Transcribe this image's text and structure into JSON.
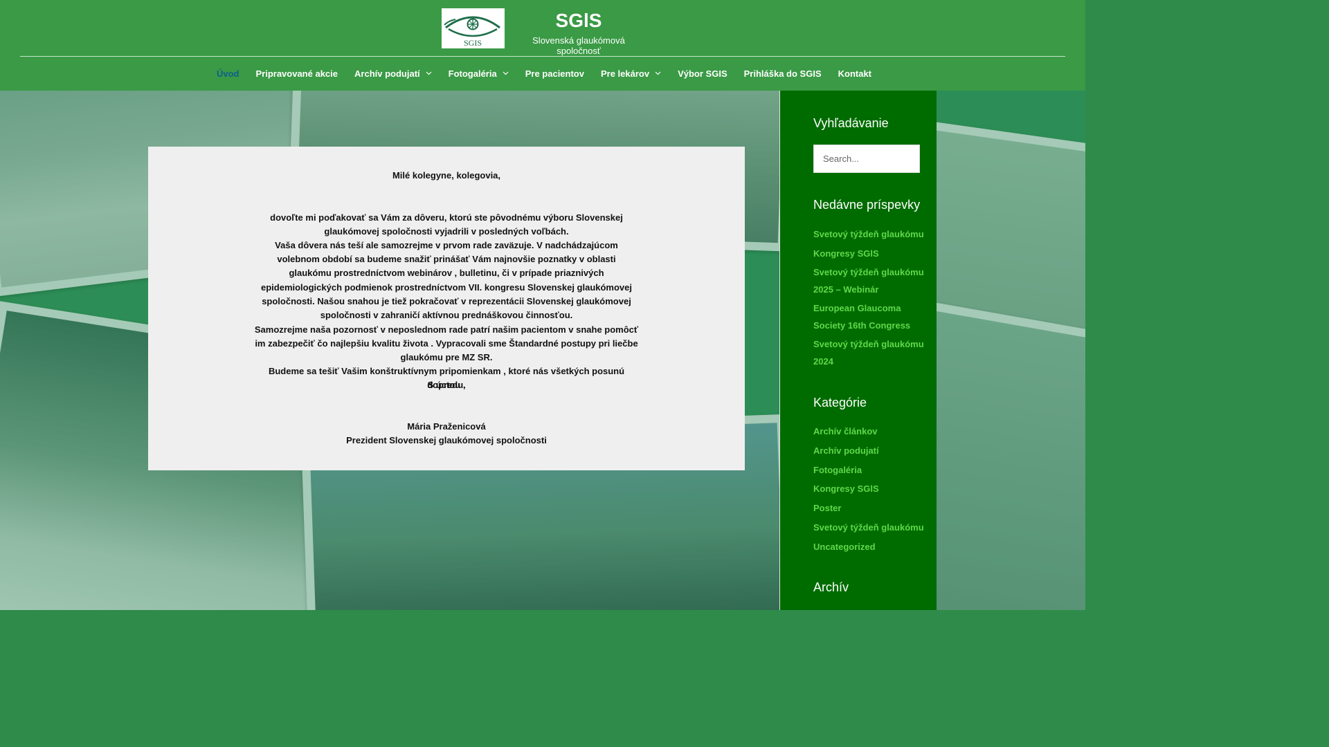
{
  "header": {
    "logo_text": "SGIS",
    "site_title": "SGlS",
    "tagline": "Slovenská glaukómová spoločnosť"
  },
  "nav": {
    "items": [
      {
        "label": "Úvod",
        "active": true,
        "dropdown": false
      },
      {
        "label": "Pripravované akcie",
        "dropdown": false
      },
      {
        "label": "Archív podujatí",
        "dropdown": true
      },
      {
        "label": "Fotogaléria",
        "dropdown": true
      },
      {
        "label": "Pre pacientov",
        "dropdown": false
      },
      {
        "label": "Pre lekárov",
        "dropdown": true
      },
      {
        "label": "Výbor SGIS",
        "dropdown": false
      },
      {
        "label": "Prihláška do SGIS",
        "dropdown": false
      },
      {
        "label": "Kontakt",
        "dropdown": false
      }
    ]
  },
  "content": {
    "greeting": "Milé kolegyne, kolegovia,",
    "para1": "dovoľte mi poďakovať sa Vám za dôveru, ktorú ste pôvodnému výboru Slovenskej glaukómovej spoločnosti vyjadrili v posledných voľbách.",
    "para2": "Vaša dôvera nás teší ale samozrejme v prvom rade zaväzuje. V nadchádzajúcom volebnom období sa budeme snažiť prinášať Vám najnovšie poznatky v oblasti glaukómu prostredníctvom webinárov , bulletinu, či v prípade priaznivých epidemiologických podmienok prostredníctvom VII. kongresu Slovenskej glaukómovej spoločnosti. Našou snahou je tiež pokračovať v reprezentácii Slovenskej glaukómovej spoločnosti v zahraničí aktívnou prednáškovou činnosťou.",
    "para3": "Samozrejme naša pozornosť v neposlednom rade patrí našim pacientom v snahe pomôcť im zabezpečiť čo najlepšiu kvalitu života . Vypracovali sme Štandardné postupy pri liečbe glaukómu pre MZ SR.",
    "para4": "Budeme sa tešiť Vašim konštruktívnym pripomienkam , ktoré nás všetkých posunú dopredu.",
    "closing": "S úctou ,",
    "signature_name": "Mária Praženicová",
    "signature_title": "Prezident Slovenskej glaukómovej spoločnosti"
  },
  "sidebar": {
    "search_heading": "Vyhľadávanie",
    "search_placeholder": "Search...",
    "recent_heading": "Nedávne príspevky",
    "recent_posts": [
      "Svetový týždeň glaukómu",
      "Kongresy SGlS",
      "Svetový týždeň glaukómu 2025 – Webinár",
      "European Glaucoma Society 16th Congress",
      "Svetový týždeň glaukómu 2024"
    ],
    "categories_heading": "Kategórie",
    "categories": [
      "Archív článkov",
      "Archív podujatí",
      "Fotogaléria",
      "Kongresy SGlS",
      "Poster",
      "Svetový týždeň glaukómu",
      "Uncategorized"
    ],
    "archive_heading": "Archív"
  },
  "colors": {
    "header_bg": "#3a9a45",
    "sidebar_bg": "#006c00",
    "link_green": "#5fd84a",
    "active_nav": "#0d5f8a"
  }
}
